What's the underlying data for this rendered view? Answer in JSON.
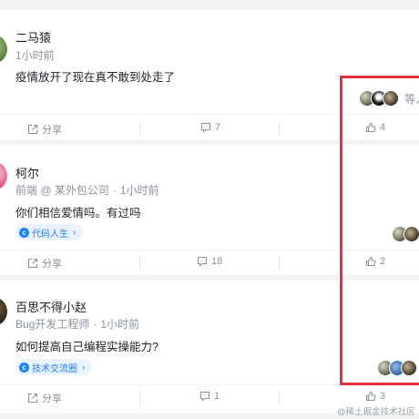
{
  "posts": [
    {
      "username": "二马猿",
      "meta_title": "",
      "meta_company": "",
      "time": "1小时前",
      "content": "疫情放开了现在真不敢到处走了",
      "topic": "",
      "share_label": "分享",
      "comment_count": "7",
      "like_count": "4",
      "likers_suffix": "等人"
    },
    {
      "username": "柯尔",
      "meta_title": "前端 @ 某外包公司",
      "time": "1小时前",
      "content": "你们相信爱情吗。有过吗",
      "topic": "代码人生",
      "share_label": "分享",
      "comment_count": "18",
      "like_count": "2"
    },
    {
      "username": "百思不得小赵",
      "meta_title": "Bug开发工程师",
      "time": "1小时前",
      "content": "如何提高自己编程实操能力?",
      "topic": "技术交流圈",
      "share_label": "分享",
      "comment_count": "1",
      "like_count": "3"
    }
  ],
  "icons": {
    "share": "share-icon",
    "comment": "comment-icon",
    "like": "thumbs-up-icon",
    "topic": "topic-icon"
  },
  "colors": {
    "accent": "#1e80ff",
    "highlight_box": "#e8313b",
    "muted_text": "#8a919f"
  },
  "watermark": "@稀土掘金技术社区"
}
